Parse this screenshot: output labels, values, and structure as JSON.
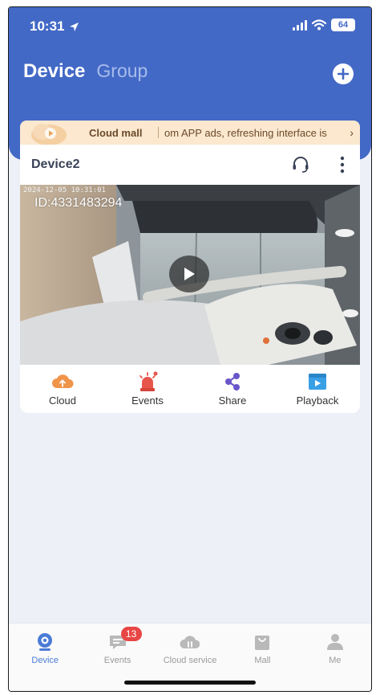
{
  "status_bar": {
    "time": "10:31",
    "battery": "64"
  },
  "header": {
    "tab_device": "Device",
    "tab_group": "Group"
  },
  "banner": {
    "title": "Cloud mall",
    "message": "om APP ads, refreshing interface is",
    "arrow": "›"
  },
  "device_card": {
    "name": "Device2",
    "video": {
      "timestamp": "2024-12-05 10:31:01",
      "camera_id": "ID:4331483294"
    },
    "actions": [
      {
        "label": "Cloud",
        "icon": "cloud-upload-icon"
      },
      {
        "label": "Events",
        "icon": "alarm-icon"
      },
      {
        "label": "Share",
        "icon": "share-icon"
      },
      {
        "label": "Playback",
        "icon": "playback-icon"
      }
    ]
  },
  "bottom_nav": {
    "items": [
      {
        "label": "Device",
        "icon": "camera-icon",
        "active": true
      },
      {
        "label": "Events",
        "icon": "message-icon",
        "badge": "13"
      },
      {
        "label": "Cloud service",
        "icon": "cloud-service-icon"
      },
      {
        "label": "Mall",
        "icon": "shopping-bag-icon"
      },
      {
        "label": "Me",
        "icon": "person-icon"
      }
    ]
  },
  "colors": {
    "header_bg": "#4369c6",
    "banner_bg": "#fbe8cf",
    "page_bg": "#eef0f8",
    "accent": "#4a7bd6",
    "badge": "#e84545"
  }
}
